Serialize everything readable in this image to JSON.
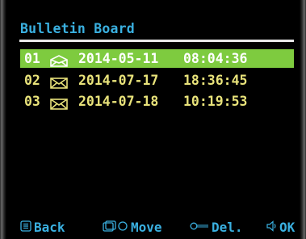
{
  "colors": {
    "background": "#000000",
    "title": "#3ab0e0",
    "text": "#e8e27a",
    "selected_bg": "#7ecb3f",
    "selected_text": "#ffffff",
    "footer": "#3ab0e0",
    "rule": "#e8e8e8"
  },
  "title": "Bulletin Board",
  "messages": [
    {
      "index": "01",
      "icon": "envelope-open-icon",
      "date": "2014-05-11",
      "time": "08:04:36",
      "selected": true
    },
    {
      "index": "02",
      "icon": "envelope-closed-icon",
      "date": "2014-07-17",
      "time": "18:36:45",
      "selected": false
    },
    {
      "index": "03",
      "icon": "envelope-closed-icon",
      "date": "2014-07-18",
      "time": "10:19:53",
      "selected": false
    }
  ],
  "footer": {
    "back": {
      "icon": "menu-icon",
      "label": "Back"
    },
    "move": {
      "icon": "rotary-knob-icon",
      "label": "Move"
    },
    "delete": {
      "icon": "key-icon",
      "label": "Del."
    },
    "ok": {
      "icon": "speaker-icon",
      "label": "OK"
    }
  }
}
